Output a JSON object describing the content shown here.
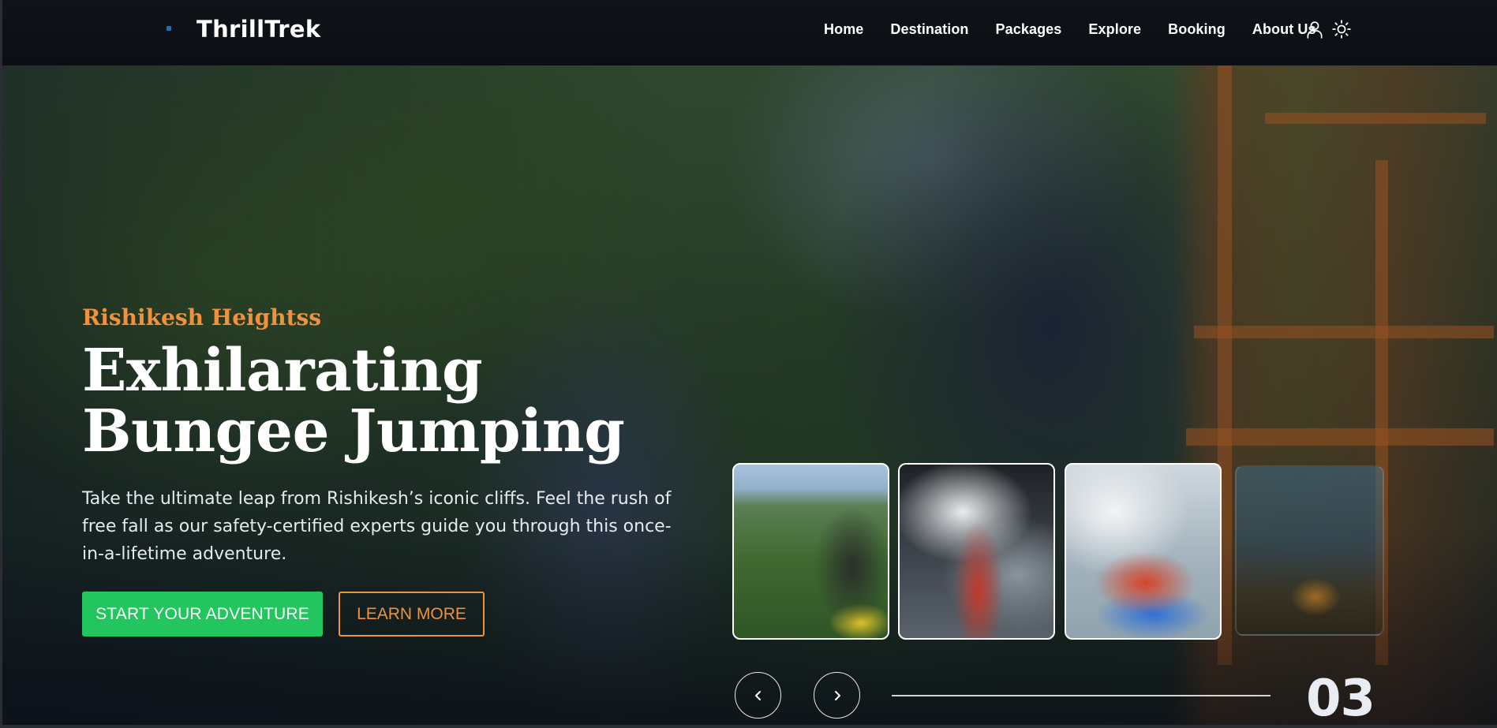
{
  "brand": {
    "name": "ThrillTrek"
  },
  "nav": {
    "items": [
      "Home",
      "Destination",
      "Packages",
      "Explore",
      "Booking",
      "About Us"
    ],
    "icons": [
      "user-icon",
      "sun-icon"
    ]
  },
  "hero": {
    "eyebrow": "Rishikesh Heightss",
    "headline_line1": "Exhilarating",
    "headline_line2": "Bungee Jumping",
    "description": "Take the ultimate leap from Rishikesh’s iconic cliffs. Feel the rush of free fall as our safety-certified experts guide you through this once-in-a-lifetime adventure.",
    "primary_button": "START YOUR ADVENTURE",
    "secondary_button": "LEARN MORE"
  },
  "carousel": {
    "current_slide": "03",
    "progress": 1.0,
    "thumbnails": [
      "bungee-jumping-thumb",
      "ganga-aarti-thumb",
      "river-rafting-thumb",
      "campfire-thumb"
    ]
  },
  "colors": {
    "accent_orange": "#f0923c",
    "primary_green": "#22c55e",
    "navbar_bg": "#0b0e13"
  }
}
